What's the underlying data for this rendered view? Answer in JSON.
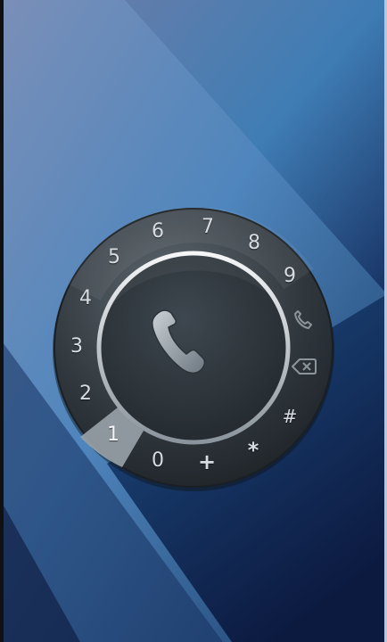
{
  "dialpad": {
    "keys": [
      {
        "label": "1",
        "selected": true
      },
      {
        "label": "2"
      },
      {
        "label": "3"
      },
      {
        "label": "4"
      },
      {
        "label": "5"
      },
      {
        "label": "6"
      },
      {
        "label": "7"
      },
      {
        "label": "8"
      },
      {
        "label": "9"
      },
      {
        "label": "0"
      },
      {
        "label": "+"
      },
      {
        "label": "*"
      },
      {
        "label": "#"
      }
    ],
    "icons": {
      "call": "phone-icon",
      "ring_call": "phone-icon",
      "backspace": "backspace-icon"
    }
  },
  "colors": {
    "bg_light": "#6f8fbd",
    "bg_mid": "#3d79ad",
    "bg_dark": "#0f1e45",
    "dial_face": "#2c3338",
    "key_text": "#d7dce2",
    "selected_segment": "#9aa3aa"
  }
}
